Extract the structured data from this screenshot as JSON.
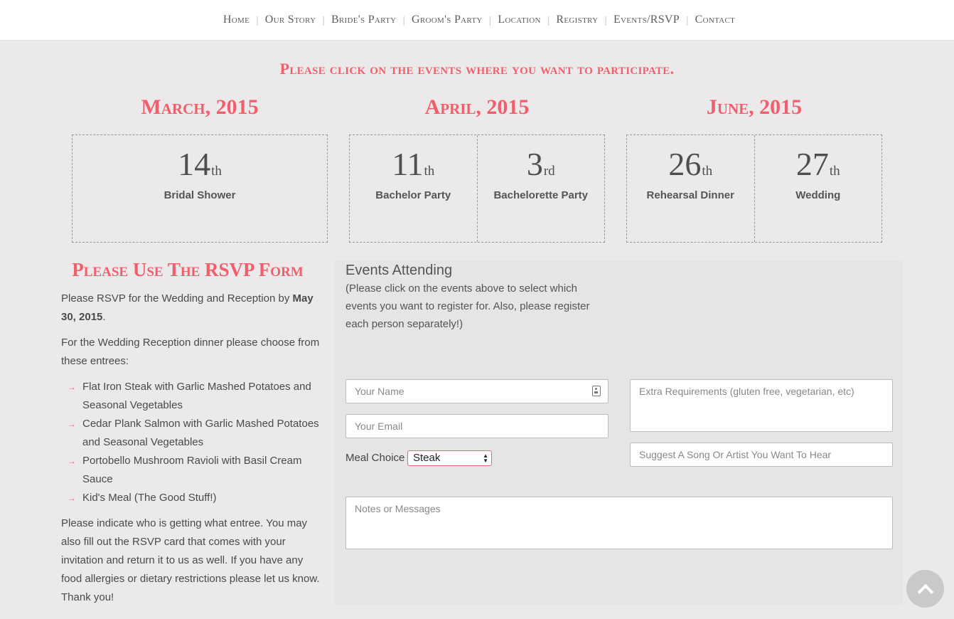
{
  "nav": {
    "items": [
      "Home",
      "Our Story",
      "Bride's Party",
      "Groom's Party",
      "Location",
      "Registry",
      "Events/RSVP",
      "Contact"
    ]
  },
  "headline": "Please click on the events where you want to participate.",
  "months": [
    {
      "title": "March, 2015",
      "events": [
        {
          "day": "14",
          "suffix": "th",
          "name": "Bridal Shower"
        }
      ]
    },
    {
      "title": "April, 2015",
      "events": [
        {
          "day": "11",
          "suffix": "th",
          "name": "Bachelor Party"
        },
        {
          "day": "3",
          "suffix": "rd",
          "name": "Bachelorette Party"
        }
      ]
    },
    {
      "title": "June, 2015",
      "events": [
        {
          "day": "26",
          "suffix": "th",
          "name": "Rehearsal Dinner"
        },
        {
          "day": "27",
          "suffix": "th",
          "name": "Wedding"
        }
      ]
    }
  ],
  "rsvp": {
    "title": "Please Use The RSVP Form",
    "p1_text": "Please RSVP for the Wedding and Reception by",
    "p1_date": "May 30, 2015",
    "p1_end": ".",
    "p2": "For the Wedding Reception dinner please choose from these entrees:",
    "entrees": [
      "Flat Iron Steak with Garlic Mashed Potatoes and Seasonal Vegetables",
      "Cedar Plank Salmon with Garlic Mashed Potatoes and Seasonal Vegetables",
      "Portobello Mushroom Ravioli with Basil Cream Sauce",
      "Kid's Meal (The Good Stuff!)"
    ],
    "p3": "Please indicate who is getting what entree. You may also fill out the RSVP card that comes with your invitation and return it to us as well. If you have any food allergies or dietary restrictions please let us know. Thank you!"
  },
  "form": {
    "title": "Events Attending",
    "note": "(Please click on the events above to select which events you want to register for. Also, please register each person separately!)",
    "name_placeholder": "Your Name",
    "email_placeholder": "Your Email",
    "meal_label": "Meal Choice",
    "meal_value": "Steak",
    "extra_placeholder": "Extra Requirements (gluten free, vegetarian, etc)",
    "song_placeholder": "Suggest A Song Or Artist You Want To Hear",
    "notes_placeholder": "Notes or Messages"
  },
  "colors": {
    "accent": "#f25e6b",
    "background": "#ebe9ea"
  }
}
